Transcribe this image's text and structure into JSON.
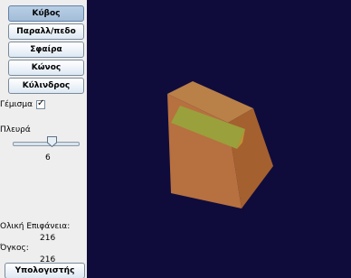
{
  "shape_buttons": [
    {
      "label": "Κύβος",
      "selected": true
    },
    {
      "label": "Παραλλ/πεδο",
      "selected": false
    },
    {
      "label": "Σφαίρα",
      "selected": false
    },
    {
      "label": "Κώνος",
      "selected": false
    },
    {
      "label": "Κύλινδρος",
      "selected": false
    }
  ],
  "fill": {
    "label": "Γέμισμα",
    "checked": true
  },
  "side": {
    "label": "Πλευρά",
    "value": "6",
    "slider_fraction": 0.6
  },
  "surface": {
    "label": "Ολική Επιφάνεια:",
    "value": "216"
  },
  "volume": {
    "label": "Όγκος:",
    "value": "216"
  },
  "calculator_button": "Υπολογιστής",
  "colors": {
    "canvas_background": "#0f0c3c",
    "cube_front": "#b7703f",
    "cube_right": "#a5602f",
    "cube_top": "#b98048",
    "cube_highlight": "#9aa03b",
    "selected_button": "#a9c1db"
  }
}
